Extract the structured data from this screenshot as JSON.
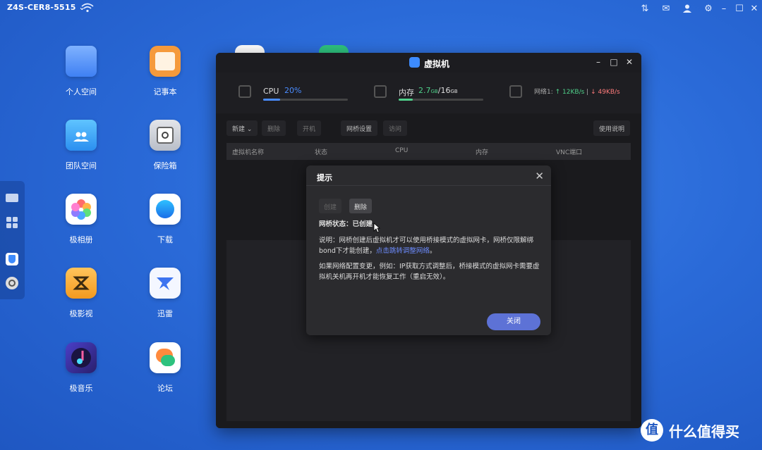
{
  "topbar": {
    "device_name": "Z4S-CER8-5515"
  },
  "desktop_apps": [
    {
      "label": "个人空间"
    },
    {
      "label": "记事本"
    },
    {
      "label": "团队空间"
    },
    {
      "label": "保险箱"
    },
    {
      "label": "极相册"
    },
    {
      "label": "下载"
    },
    {
      "label": "极影视"
    },
    {
      "label": "迅雷"
    },
    {
      "label": "极音乐"
    },
    {
      "label": "论坛"
    }
  ],
  "window": {
    "title": "虚拟机",
    "stats": {
      "cpu_label": "CPU",
      "cpu_value": "20%",
      "cpu_percent": 20,
      "mem_label": "内存",
      "mem_used": "2.7",
      "mem_used_unit": "GB",
      "mem_sep": "/",
      "mem_total": "16",
      "mem_total_unit": "GB",
      "net_label": "网络1:",
      "net_up": "↑ 12KB/s",
      "net_sep": "|",
      "net_down": "↓ 49KB/s"
    },
    "toolbar": {
      "new": "新建",
      "btn2": "删除",
      "btn3": "开机",
      "bridge": "网桥设置",
      "visit": "访问",
      "help": "使用说明"
    },
    "table_headers": [
      "虚拟机名称",
      "状态",
      "CPU",
      "内存",
      "VNC端口"
    ]
  },
  "dialog": {
    "title": "提示",
    "create_btn": "创建",
    "delete_btn": "删除",
    "status_label": "网桥状态：",
    "status_value": "已创建",
    "desc_prefix": "说明：网桥创建后虚拟机才可以使用桥接模式的虚拟网卡，网桥仅限解绑bond下才能创建，",
    "desc_link": "点击跳转调整网络",
    "desc_suffix": "。",
    "note": "如果网络配置变更，例如：IP获取方式调整后，桥接模式的虚拟网卡需要虚拟机关机再开机才能恢复工作（重启无效）。",
    "close_btn": "关闭"
  },
  "watermark": {
    "symbol": "值",
    "text": "什么值得买"
  },
  "colors": {
    "accent": "#4a8cff",
    "dialog_button": "#5d72d6",
    "link": "#6d8cff"
  }
}
